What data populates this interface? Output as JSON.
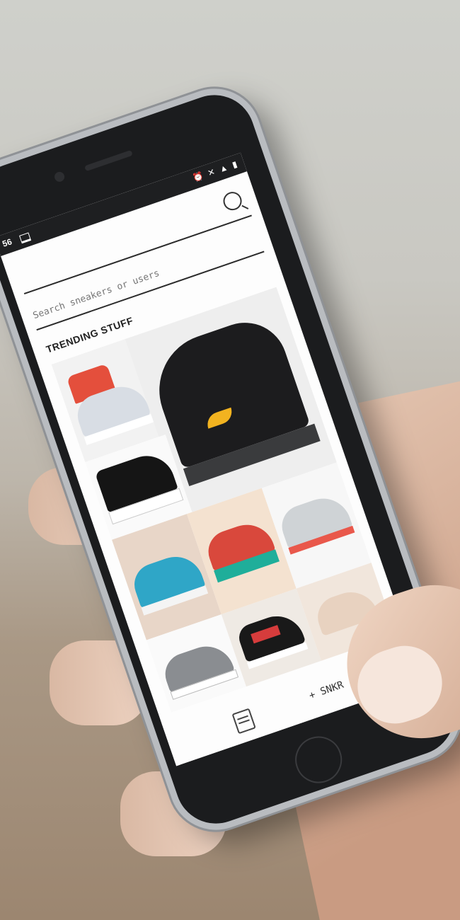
{
  "status": {
    "time": "56",
    "icons": "⏰ ✕ ▲ ▮"
  },
  "search": {
    "placeholder": "Search sneakers or users"
  },
  "section": {
    "title": "TRENDING STUFF"
  },
  "nav": {
    "add_label": "+ SNKR"
  }
}
